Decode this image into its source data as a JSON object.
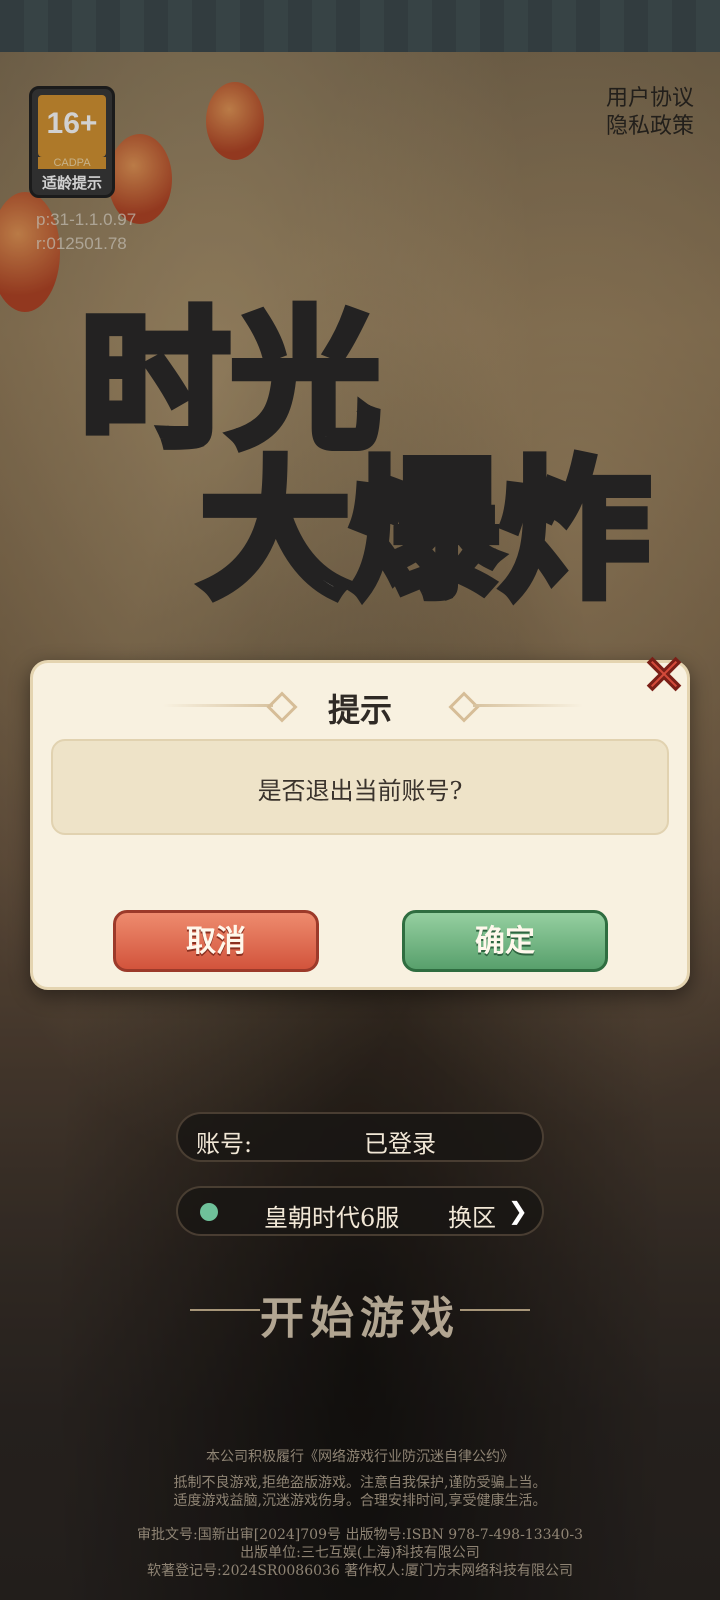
{
  "rating": {
    "age": "16+",
    "org": "CADPA",
    "label": "适龄提示"
  },
  "version": {
    "line1": "p:31-1.1.0.97",
    "line2": "r:012501.78"
  },
  "links": {
    "user_agreement": "用户协议",
    "privacy_policy": "隐私政策"
  },
  "logo": {
    "line1": "时光",
    "line2": "大爆炸"
  },
  "dialog": {
    "title": "提示",
    "message": "是否退出当前账号?",
    "cancel_label": "取消",
    "confirm_label": "确定"
  },
  "account": {
    "label": "账号:",
    "value": "已登录"
  },
  "server": {
    "name": "皇朝时代6服",
    "switch_label": "换区",
    "status_color": "#6fc19a"
  },
  "start_label": "开始游戏",
  "footer": {
    "line1": "本公司积极履行《网络游戏行业防沉迷自律公约》",
    "line2": "抵制不良游戏,拒绝盗版游戏。注意自我保护,谨防受骗上当。",
    "line3": "适度游戏益脑,沉迷游戏伤身。合理安排时间,享受健康生活。",
    "line4": "审批文号:国新出审[2024]709号 出版物号:ISBN 978-7-498-13340-3",
    "line5": "出版单位:三七互娱(上海)科技有限公司",
    "line6": "软著登记号:2024SR0086036 著作权人:厦门方末网络科技有限公司"
  },
  "colors": {
    "cancel": "#d2543c",
    "confirm": "#58a06c",
    "dialog_bg": "#f8f1e0"
  }
}
